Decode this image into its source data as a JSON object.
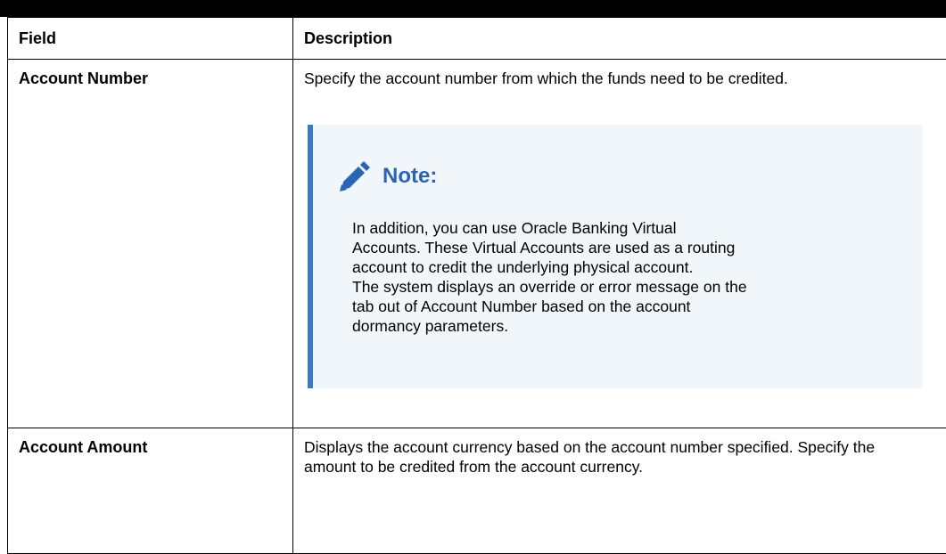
{
  "table": {
    "header_field": "Field",
    "header_description": "Description",
    "rows": [
      {
        "field": "Account Number",
        "description": "Specify the account number from which the funds need to be credited.",
        "note": {
          "icon": "pencil-icon",
          "title": "Note:",
          "lines": [
            "In addition, you can use Oracle Banking Virtual",
            "Accounts. These Virtual Accounts are used as a routing",
            "account to credit the underlying physical account.",
            "The system displays an override or error message on the",
            "tab out of Account Number based on the account",
            "dormancy parameters."
          ]
        }
      },
      {
        "field": "Account Amount",
        "description": "Displays the account currency based on the account number specified. Specify the amount to be credited from the account currency."
      }
    ]
  },
  "colors": {
    "note_accent": "#3a78c9",
    "note_title": "#2b64b3",
    "note_background": "#f1f6fb"
  }
}
